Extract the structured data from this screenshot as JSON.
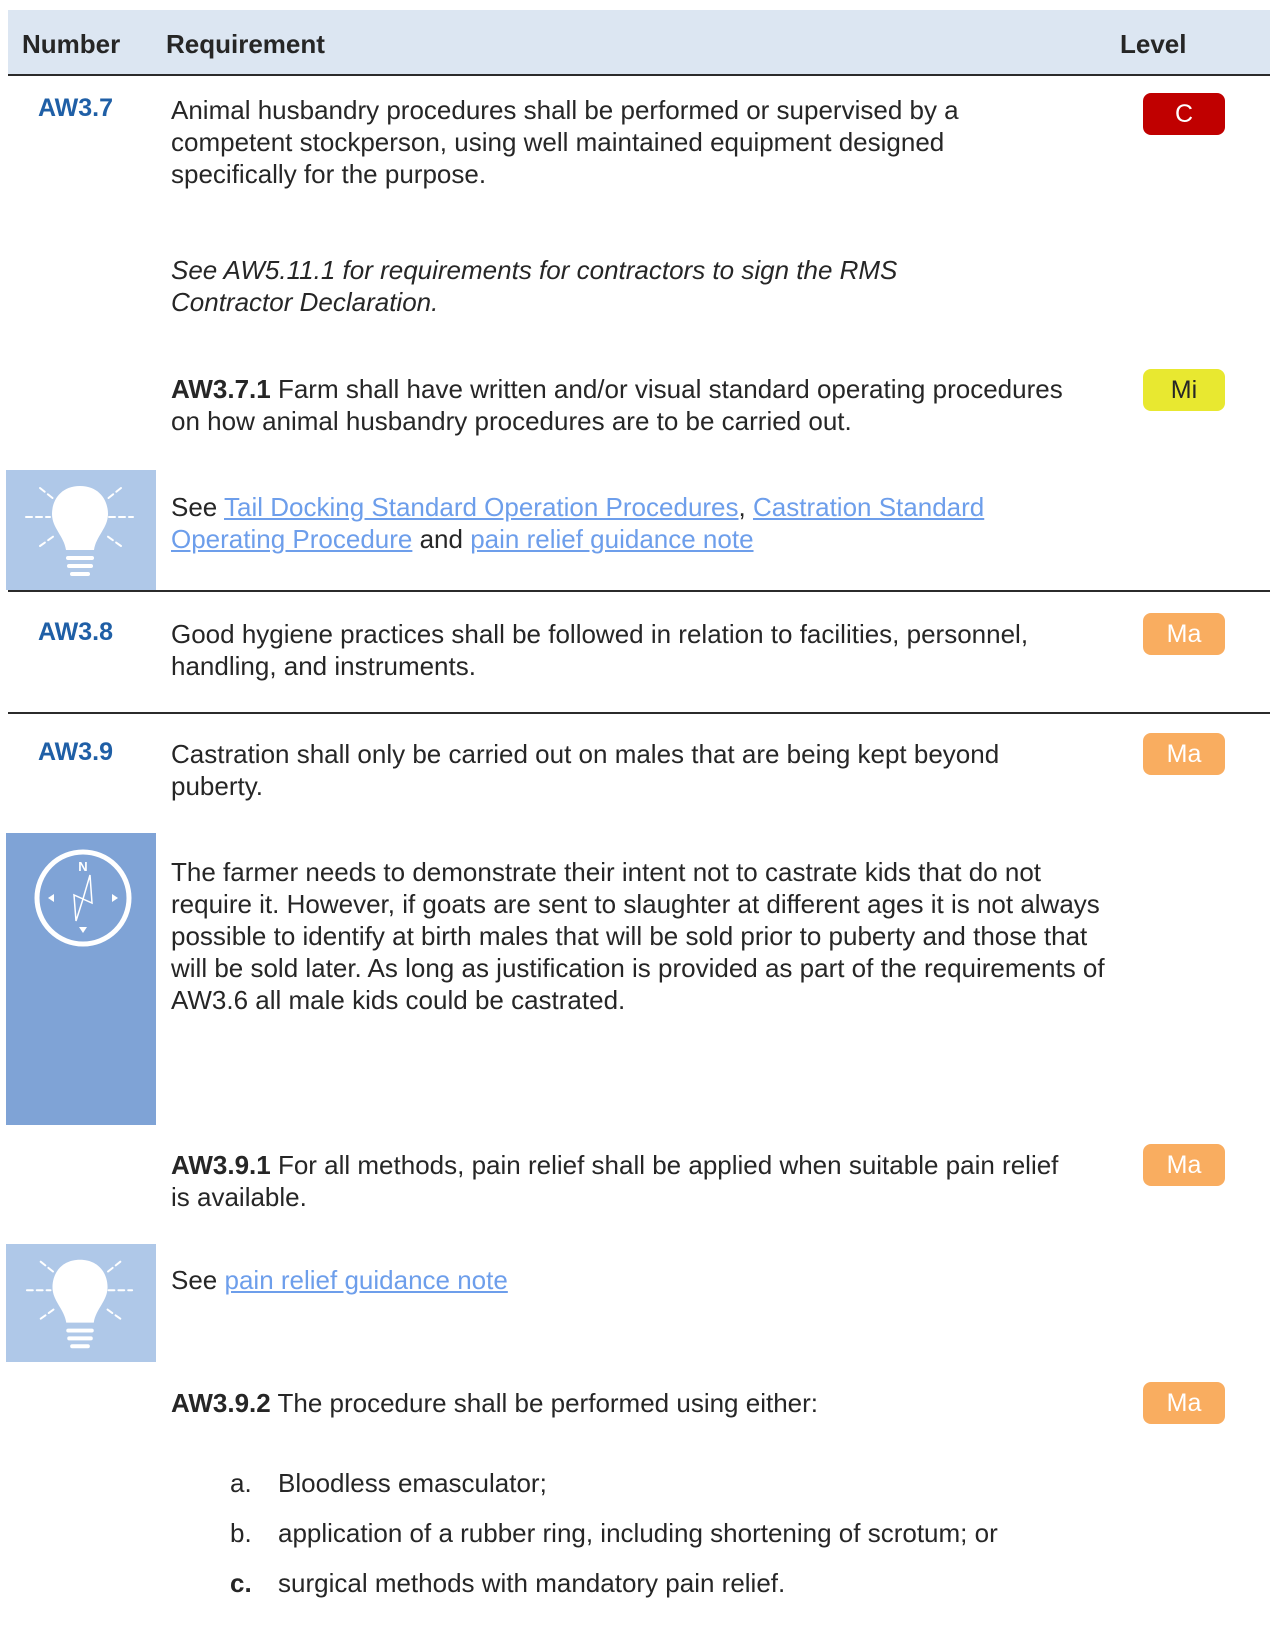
{
  "header": {
    "number": "Number",
    "requirement": "Requirement",
    "level": "Level"
  },
  "aw37": {
    "number": "AW3.7",
    "text": "Animal husbandry procedures shall be performed or supervised by a competent stockperson, using well maintained equipment designed specifically for the purpose.",
    "level": "C",
    "note": "See AW5.11.1 for requirements for contractors to sign the RMS Contractor Declaration."
  },
  "aw371": {
    "id": "AW3.7.1",
    "text": " Farm shall have written and/or visual standard operating procedures on how animal husbandry procedures are to be carried out.",
    "level": "Mi"
  },
  "tip1": {
    "prefix": "See ",
    "link1": "Tail Docking Standard Operation Procedures",
    "sep1": ", ",
    "link2": "Castration Standard Operating Procedure",
    "sep2": " and ",
    "link3": "pain relief guidance note"
  },
  "aw38": {
    "number": "AW3.8",
    "text": "Good hygiene practices shall be followed in relation to facilities, personnel, handling, and instruments.",
    "level": "Ma"
  },
  "aw39": {
    "number": "AW3.9",
    "text": "Castration shall only be carried out on males that are being kept beyond puberty.",
    "level": "Ma"
  },
  "guidance": {
    "compass_letter": "N",
    "text": "The farmer needs to demonstrate their intent not to castrate kids that do not require it. However, if goats are sent to slaughter at different ages it is not always possible to identify at birth males that will be sold prior to puberty and those that will be sold later. As long as justification is provided as part of the requirements of AW3.6 all male kids could be castrated."
  },
  "aw391": {
    "id": "AW3.9.1",
    "text": " For all methods, pain relief shall be applied when suitable pain relief is available.",
    "level": "Ma"
  },
  "tip2": {
    "prefix": "See ",
    "link": "pain relief guidance note"
  },
  "aw392": {
    "id": "AW3.9.2",
    "text": " The procedure shall be performed using either:",
    "level": "Ma",
    "items": [
      {
        "marker": "a.",
        "text": "Bloodless emasculator;"
      },
      {
        "marker": "b.",
        "text": "application of a rubber ring, including shortening of scrotum; or"
      },
      {
        "marker": "c.",
        "text": "surgical methods with mandatory pain relief."
      }
    ]
  },
  "colors": {
    "header_bg": "#dce6f2",
    "number_blue": "#1f5fa6",
    "link_blue": "#6d9eeb",
    "critical_red": "#c00000",
    "minor_yellow": "#e8e830",
    "major_orange": "#f9ad60",
    "tip_box": "#afc8e8",
    "guidance_box": "#7fa3d6"
  },
  "icons": {
    "tip": "lightbulb-icon",
    "guidance": "compass-icon"
  }
}
